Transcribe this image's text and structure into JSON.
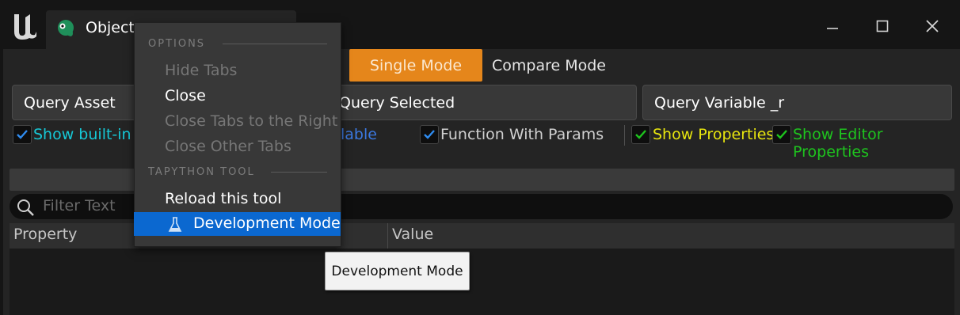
{
  "window": {
    "tab_title": "Object",
    "controls": {
      "minimize_icon": "minimize-icon",
      "maximize_icon": "maximize-icon",
      "close_icon": "close-icon"
    }
  },
  "modes": {
    "single": "Single Mode",
    "compare": "Compare Mode",
    "active": "Single Mode"
  },
  "query_buttons": {
    "asset": "Query Asset",
    "selected": "Query Selected",
    "variable": "Query Variable _r"
  },
  "filters": {
    "show_builtin": {
      "label": "Show built-in",
      "checked": true
    },
    "variable_partial": {
      "label": "lable"
    },
    "function_with_params": {
      "label": "Function With Params",
      "checked": true
    },
    "show_properties": {
      "label": "Show Properties",
      "checked": true
    },
    "show_editor_properties": {
      "label": "Show Editor Properties",
      "checked": true
    }
  },
  "search": {
    "placeholder": "Filter Text"
  },
  "table": {
    "columns": [
      "Property",
      "Value"
    ]
  },
  "context_menu": {
    "sections": [
      {
        "title": "OPTIONS",
        "items": [
          {
            "label": "Hide Tabs",
            "enabled": false
          },
          {
            "label": "Close",
            "enabled": true
          },
          {
            "label": "Close Tabs to the Right",
            "enabled": false
          },
          {
            "label": "Close Other Tabs",
            "enabled": false
          }
        ]
      },
      {
        "title": "TAPYTHON TOOL",
        "items": [
          {
            "label": "Reload this tool",
            "enabled": true
          },
          {
            "label": "Development Mode",
            "enabled": true,
            "highlighted": true,
            "icon": "flask-icon"
          }
        ]
      }
    ]
  },
  "tooltip": {
    "text": "Development Mode"
  },
  "colors": {
    "accent_orange": "#e5861b",
    "menu_highlight": "#0b68d0",
    "builtin_cyan": "#16c8d6",
    "properties_yellow": "#e8e60e",
    "editor_props_green": "#1ec41e"
  }
}
